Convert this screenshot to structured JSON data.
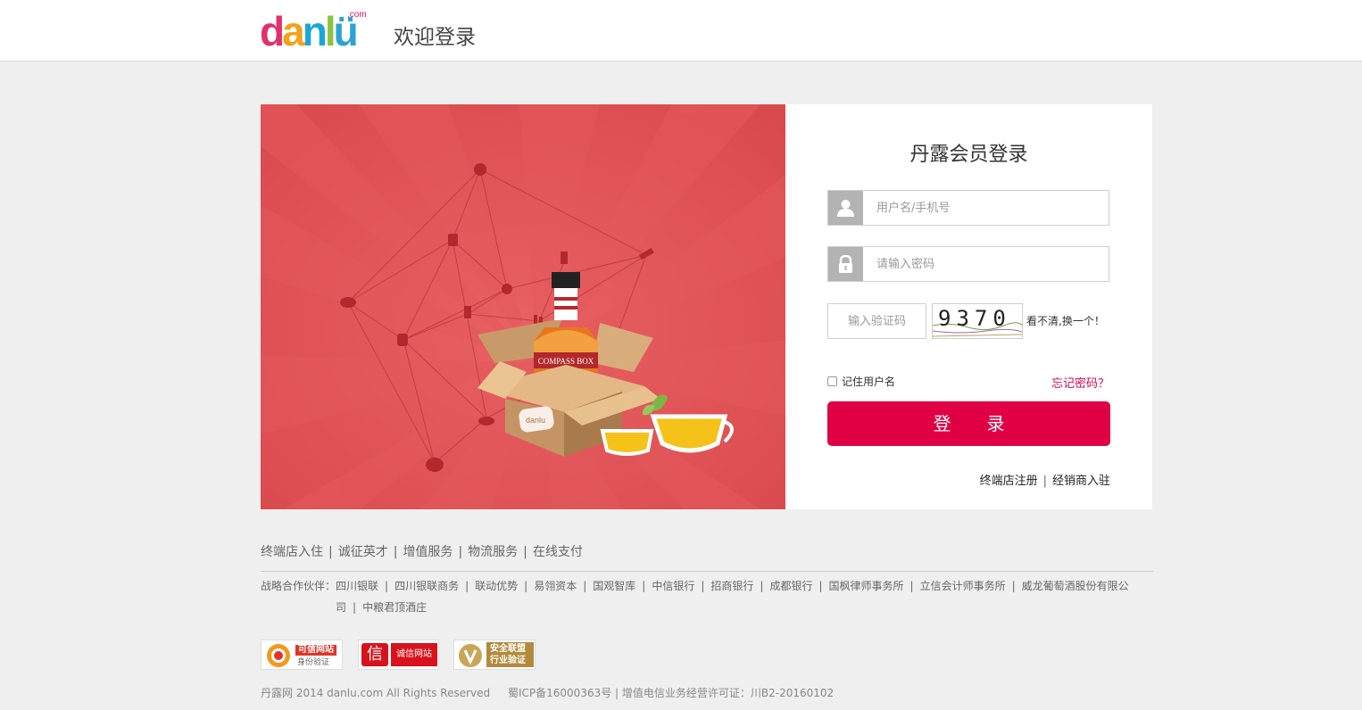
{
  "header": {
    "logo_text": "danlu",
    "logo_suffix": ".com",
    "title": "欢迎登录",
    "logo_colors": [
      "#e1306c",
      "#f3a21b",
      "#1aa7d8",
      "#8cc33f",
      "#2aa4d6"
    ]
  },
  "banner": {
    "bottle_label": "COMPASS BOX",
    "box_label": "danlu",
    "background_color": "#e05457"
  },
  "login": {
    "title": "丹露会员登录",
    "username_placeholder": "用户名/手机号",
    "password_placeholder": "请输入密码",
    "captcha_placeholder": "输入验证码",
    "captcha_code": "9370",
    "captcha_refresh": "看不清,换一个！",
    "remember_label": "记住用户名",
    "forgot_label": "忘记密码？",
    "submit_label": "登　　录",
    "register_terminal": "终端店注册",
    "register_separator": "|",
    "register_dealer": "经销商入驻",
    "accent_color": "#e00044"
  },
  "footer": {
    "nav": [
      "终端店入住",
      "诚征英才",
      "增值服务",
      "物流服务",
      "在线支付"
    ],
    "partners_label": "战略合作伙伴：",
    "partners": [
      "四川银联",
      "四川银联商务",
      "联动优势",
      "易翎资本",
      "国观智库",
      "中信银行",
      "招商银行",
      "成都银行",
      "国枫律师事务所",
      "立信会计师事务所",
      "威龙葡萄酒股份有限公司",
      "中粮君顶酒庄"
    ],
    "badges": [
      {
        "line1": "可信网站",
        "line2": "身份验证"
      },
      {
        "line1": "信",
        "line2": "诚信网站"
      },
      {
        "line1": "安全联盟",
        "line2": "行业验证"
      }
    ],
    "copyright": "丹露网  2014 danlu.com All Rights Reserved",
    "icp": "蜀ICP备16000363号 | 增值电信业务经营许可证：川B2-20160102"
  }
}
